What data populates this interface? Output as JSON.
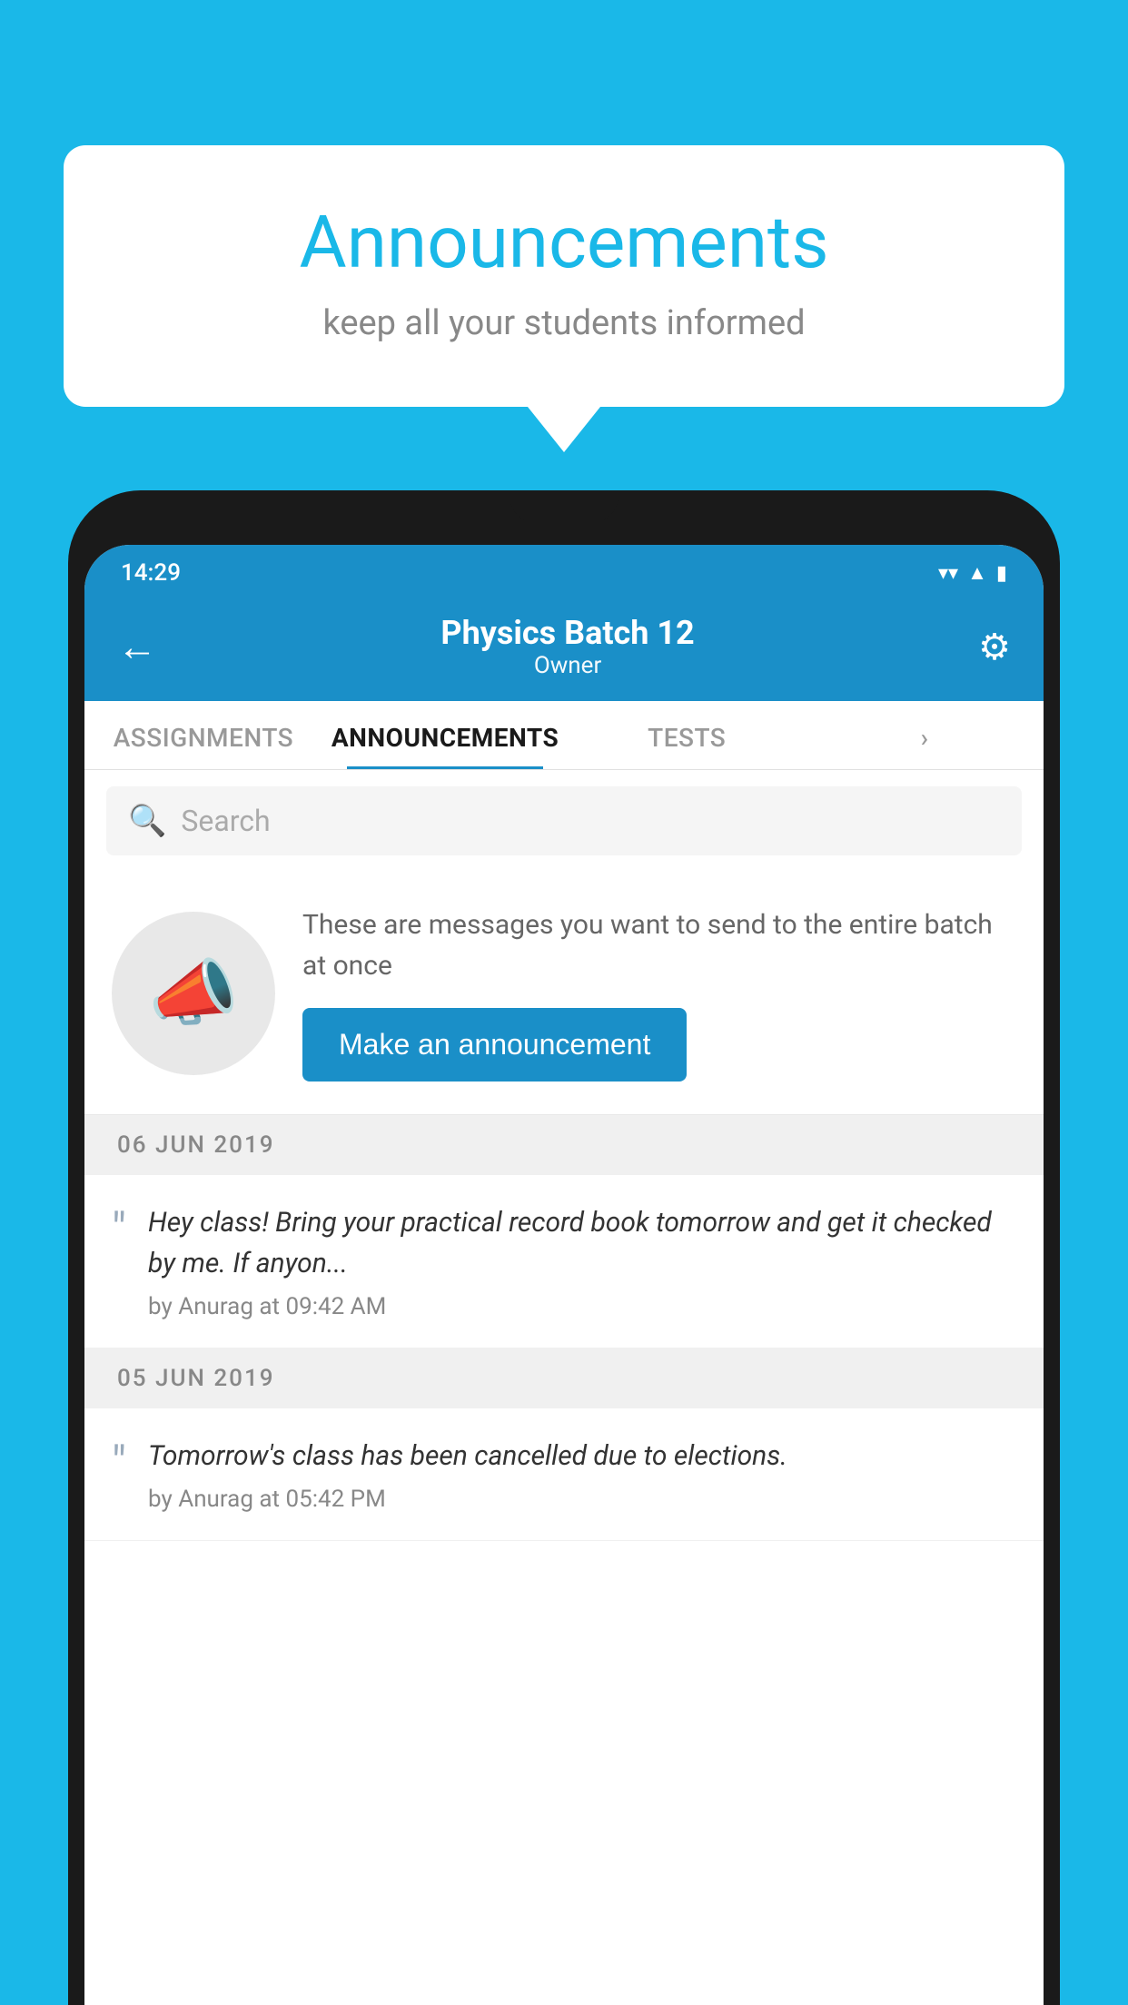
{
  "background_color": "#1ab8e8",
  "speech_bubble": {
    "title": "Announcements",
    "subtitle": "keep all your students informed"
  },
  "status_bar": {
    "time": "14:29",
    "icons": [
      "wifi",
      "signal",
      "battery"
    ]
  },
  "top_bar": {
    "back_label": "←",
    "batch_name": "Physics Batch 12",
    "batch_role": "Owner",
    "settings_label": "⚙"
  },
  "tabs": [
    {
      "label": "ASSIGNMENTS",
      "active": false
    },
    {
      "label": "ANNOUNCEMENTS",
      "active": true
    },
    {
      "label": "TESTS",
      "active": false
    },
    {
      "label": "...",
      "active": false
    }
  ],
  "search": {
    "placeholder": "Search"
  },
  "promo": {
    "description": "These are messages you want to send to the entire batch at once",
    "button_label": "Make an announcement"
  },
  "announcements": [
    {
      "date": "06  JUN  2019",
      "text": "Hey class! Bring your practical record book tomorrow and get it checked by me. If anyon...",
      "author": "by Anurag at 09:42 AM"
    },
    {
      "date": "05  JUN  2019",
      "text": "Tomorrow's class has been cancelled due to elections.",
      "author": "by Anurag at 05:42 PM"
    }
  ]
}
